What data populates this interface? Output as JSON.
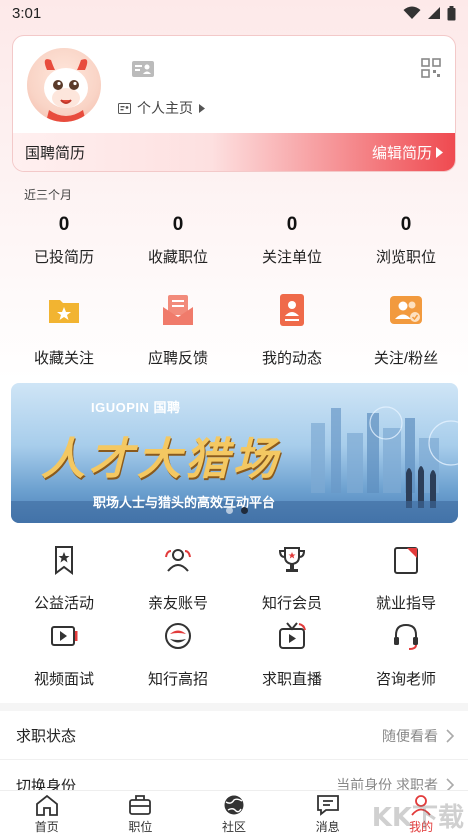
{
  "status_bar": {
    "time": "3:01"
  },
  "profile": {
    "home_link": "个人主页",
    "resume_label": "国聘简历",
    "edit_resume": "编辑简历"
  },
  "stats": {
    "period": "近三个月",
    "items": [
      {
        "value": "0",
        "label": "已投简历"
      },
      {
        "value": "0",
        "label": "收藏职位"
      },
      {
        "value": "0",
        "label": "关注单位"
      },
      {
        "value": "0",
        "label": "浏览职位"
      }
    ]
  },
  "quick": [
    {
      "label": "收藏关注",
      "icon": "folder-star-icon",
      "color": "#f2b431"
    },
    {
      "label": "应聘反馈",
      "icon": "envelope-icon",
      "color": "#f07b6b"
    },
    {
      "label": "我的动态",
      "icon": "profile-card-icon",
      "color": "#ef6a4a"
    },
    {
      "label": "关注/粉丝",
      "icon": "users-icon",
      "color": "#f29a3e"
    }
  ],
  "banner": {
    "brand": "IGUOPIN 国聘",
    "headline": "人才大猎场",
    "subtitle": "职场人士与猎头的高效互动平台",
    "active_slide": 2,
    "slide_count": 2
  },
  "services": [
    {
      "label": "公益活动",
      "icon": "ribbon-star-icon"
    },
    {
      "label": "亲友账号",
      "icon": "friends-icon"
    },
    {
      "label": "知行会员",
      "icon": "trophy-icon"
    },
    {
      "label": "就业指导",
      "icon": "guide-book-icon"
    },
    {
      "label": "视频面试",
      "icon": "video-play-icon"
    },
    {
      "label": "知行高招",
      "icon": "fish-emblem-icon"
    },
    {
      "label": "求职直播",
      "icon": "live-tv-icon"
    },
    {
      "label": "咨询老师",
      "icon": "headset-icon"
    }
  ],
  "settings": {
    "job_status": {
      "title": "求职状态",
      "value": "随便看看"
    },
    "switch_identity": {
      "title": "切换身份",
      "value": "当前身份 求职者"
    }
  },
  "tabs": [
    {
      "label": "首页",
      "icon": "home-icon"
    },
    {
      "label": "职位",
      "icon": "briefcase-icon"
    },
    {
      "label": "社区",
      "icon": "globe-icon"
    },
    {
      "label": "消息",
      "icon": "message-icon"
    },
    {
      "label": "我的",
      "icon": "user-icon",
      "active": true
    }
  ],
  "watermark": "KK下载",
  "colors": {
    "accent": "#e23b3b",
    "banner_gold": "#f4c862"
  }
}
